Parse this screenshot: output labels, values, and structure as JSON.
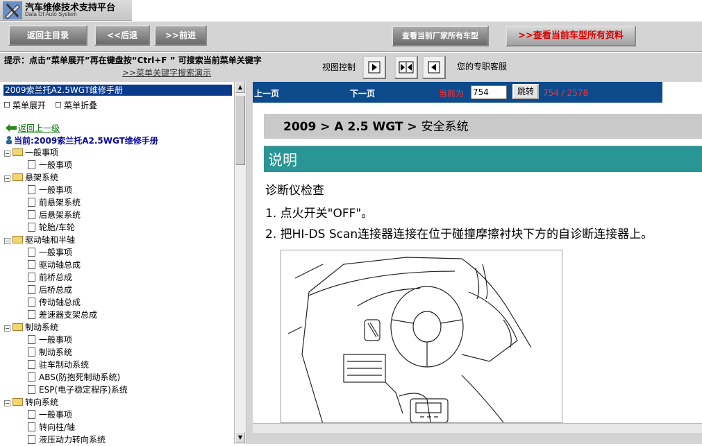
{
  "header": {
    "title": "汽车维修技术支持平台",
    "subtitle": "Data Of Auto System"
  },
  "nav": {
    "home": "返回主目录",
    "back": "<<后退",
    "forward": ">>前进",
    "all_models": "查看当前厂家所有车型",
    "all_docs": "查看当前车型所有资料",
    "all_docs_prefix": ">>"
  },
  "hint": {
    "text": "提示：点击“菜单展开”再在键盘按“Ctrl+F ” 可搜索当前菜单关键字",
    "link": ">>菜单关键字搜索演示"
  },
  "view": {
    "label": "视图控制",
    "service": "您的专职客服"
  },
  "sidebar": {
    "manual_title": "2009索兰托A2.5WGT维修手册",
    "expand": "菜单展开",
    "collapse": "菜单折叠",
    "back_up": "返回上一级",
    "current": "当前:2009索兰托A2.5WGT维修手册",
    "items": [
      {
        "label": "一般事项",
        "type": "folder"
      },
      {
        "label": "一般事项",
        "type": "doc"
      },
      {
        "label": "悬架系统",
        "type": "folder"
      },
      {
        "label": "一般事项",
        "type": "doc"
      },
      {
        "label": "前悬架系统",
        "type": "doc"
      },
      {
        "label": "后悬架系统",
        "type": "doc"
      },
      {
        "label": "轮胎/车轮",
        "type": "doc"
      },
      {
        "label": "驱动轴和半轴",
        "type": "folder"
      },
      {
        "label": "一般事项",
        "type": "doc"
      },
      {
        "label": "驱动轴总成",
        "type": "doc"
      },
      {
        "label": "前桥总成",
        "type": "doc"
      },
      {
        "label": "后桥总成",
        "type": "doc"
      },
      {
        "label": "传动轴总成",
        "type": "doc"
      },
      {
        "label": "差速器支架总成",
        "type": "doc"
      },
      {
        "label": "制动系统",
        "type": "folder"
      },
      {
        "label": "一般事项",
        "type": "doc"
      },
      {
        "label": "制动系统",
        "type": "doc"
      },
      {
        "label": "驻车制动系统",
        "type": "doc"
      },
      {
        "label": "ABS(防抱死制动系统)",
        "type": "doc"
      },
      {
        "label": "ESP(电子稳定程序)系统",
        "type": "doc"
      },
      {
        "label": "转向系统",
        "type": "folder"
      },
      {
        "label": "一般事项",
        "type": "doc"
      },
      {
        "label": "转向柱/轴",
        "type": "doc"
      },
      {
        "label": "液压动力转向系统",
        "type": "doc"
      }
    ]
  },
  "pager": {
    "prev": "上一页",
    "next": "下一页",
    "current_label": "当前为",
    "page_value": "754",
    "go": "跳转",
    "count": "754 / 2578"
  },
  "content": {
    "crumb_bold": "2009 > A 2.5 WGT >",
    "crumb_last": "安全系统",
    "section": "说明",
    "heading": "诊断仪检查",
    "step1": "1. 点火开关\"OFF\"。",
    "step2": "2. 把HI-DS Scan连接器连接在位于碰撞摩擦衬块下方的自诊断连接器上。"
  }
}
